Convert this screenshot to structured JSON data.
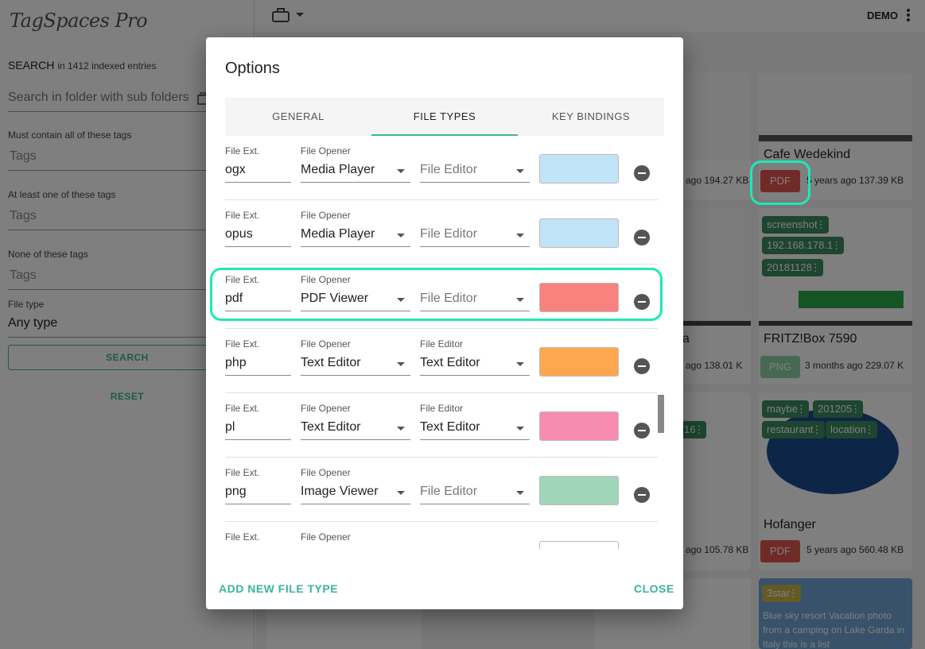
{
  "app": {
    "logo": "TagSpaces Pro",
    "user": "DEMO"
  },
  "search": {
    "title": "SEARCH",
    "indexed": "in 1412 indexed entries",
    "placeholder": "Search in folder with sub folders",
    "must_label": "Must contain all of these tags",
    "must_placeholder": "Tags",
    "atleast_label": "At least one of these tags",
    "atleast_placeholder": "Tags",
    "none_label": "None of these tags",
    "none_placeholder": "Tags",
    "filetype_label": "File type",
    "filetype_value": "Any type",
    "search_button": "SEARCH",
    "reset_button": "RESET"
  },
  "cards": {
    "cafe": {
      "title": "Cafe Wedekind",
      "badge": "PDF",
      "meta": "5 years ago 137.39 KB",
      "left_meta": "ago 194.27 KB"
    },
    "fritz": {
      "title": "FRITZ!Box 7590",
      "badge": "PNG",
      "meta": "3 months ago 229.07 K",
      "tags": [
        "screenshot",
        "192.168.178.1",
        "20181128"
      ],
      "left_meta": "ago 138.01 K",
      "left_title": "a"
    },
    "hofanger": {
      "title": "Hofanger",
      "badge": "PDF",
      "meta": "5 years ago 560.48 KB",
      "tags": [
        "maybe",
        "201205",
        "restaurant",
        "location"
      ],
      "left_meta": "ago 105.78 KB",
      "left_tag": "16"
    },
    "bluesky": {
      "tag": "3star",
      "text": "Blue sky resort Vacation photo from a camping on Lake Garda in Italy this is a list"
    }
  },
  "dialog": {
    "title": "Options",
    "tabs": [
      {
        "label": "GENERAL"
      },
      {
        "label": "FILE TYPES"
      },
      {
        "label": "KEY BINDINGS"
      }
    ],
    "labels": {
      "ext": "File Ext.",
      "opener": "File Opener",
      "editor": "File Editor"
    },
    "rows": [
      {
        "ext": "ogx",
        "opener": "Media Player",
        "editor": "File Editor",
        "editor_set": false,
        "color": "#c1e3f7"
      },
      {
        "ext": "opus",
        "opener": "Media Player",
        "editor": "File Editor",
        "editor_set": false,
        "color": "#c1e3f7"
      },
      {
        "ext": "pdf",
        "opener": "PDF Viewer",
        "editor": "File Editor",
        "editor_set": false,
        "color": "#f8837e"
      },
      {
        "ext": "php",
        "opener": "Text Editor",
        "editor": "Text Editor",
        "editor_set": true,
        "color": "#ffa74f"
      },
      {
        "ext": "pl",
        "opener": "Text Editor",
        "editor": "Text Editor",
        "editor_set": true,
        "color": "#f88cb0"
      },
      {
        "ext": "png",
        "opener": "Image Viewer",
        "editor": "File Editor",
        "editor_set": false,
        "color": "#9fd5b9"
      }
    ],
    "add_button": "ADD NEW FILE TYPE",
    "close_button": "CLOSE"
  },
  "colors": {
    "accent": "#3cb59a",
    "highlight": "#1de9b6"
  }
}
